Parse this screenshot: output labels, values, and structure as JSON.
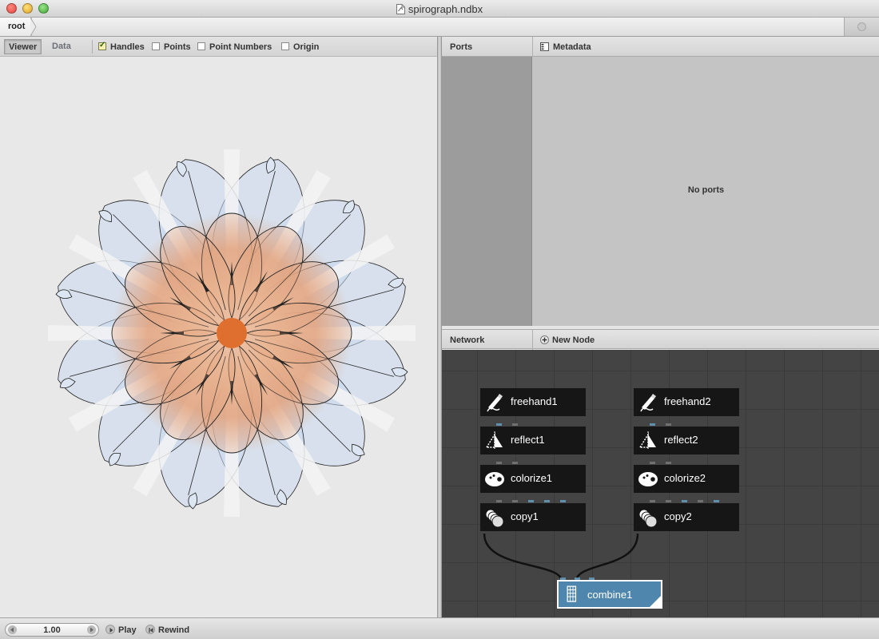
{
  "window": {
    "title": "spirograph.ndbx"
  },
  "breadcrumb": {
    "root": "root"
  },
  "viewer": {
    "tabs": {
      "viewer": "Viewer",
      "data": "Data"
    },
    "options": [
      {
        "label": "Handles",
        "checked": true
      },
      {
        "label": "Points",
        "checked": false
      },
      {
        "label": "Point Numbers",
        "checked": false
      },
      {
        "label": "Origin",
        "checked": false
      }
    ]
  },
  "ports": {
    "header": "Ports",
    "metadata_header": "Metadata",
    "empty_text": "No ports"
  },
  "network": {
    "header": "Network",
    "new_node_label": "New Node",
    "nodes": {
      "freehand1": "freehand1",
      "reflect1": "reflect1",
      "colorize1": "colorize1",
      "copy1": "copy1",
      "freehand2": "freehand2",
      "reflect2": "reflect2",
      "colorize2": "colorize2",
      "copy2": "copy2",
      "combine1": "combine1"
    },
    "colors": {
      "node_bg": "#161616",
      "combine_bg": "#4e86ad",
      "canvas_bg": "#444444",
      "port_blue": "#5f8faa"
    }
  },
  "playback": {
    "frame": "1.00",
    "play_label": "Play",
    "rewind_label": "Rewind"
  }
}
